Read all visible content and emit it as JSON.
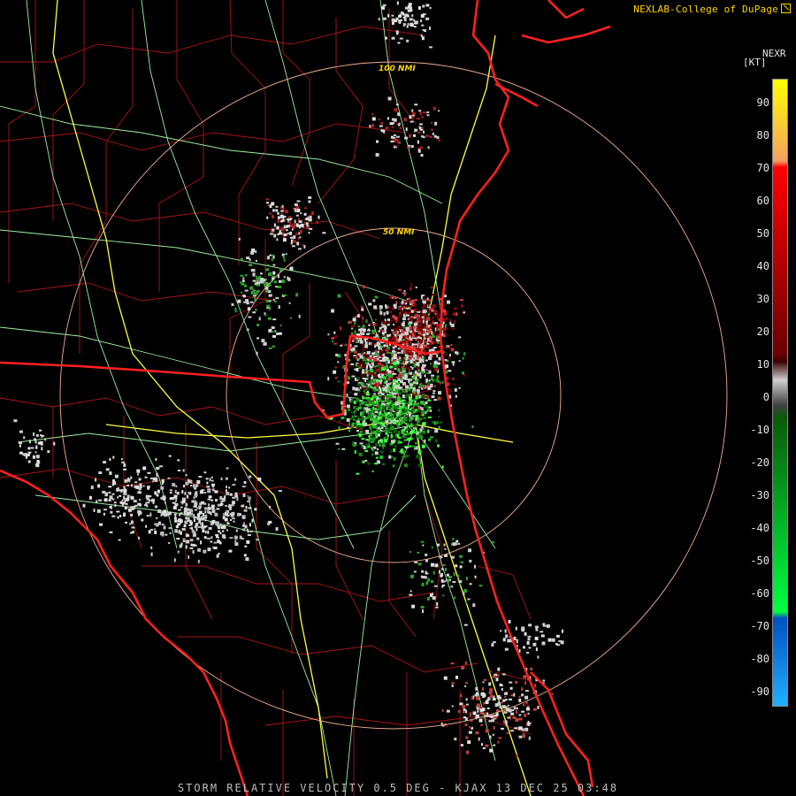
{
  "header": {
    "credit": "NEXLAB-College of DuPage",
    "credit_icon": "external-link-icon"
  },
  "legend": {
    "product": "NEXR",
    "unit": "[KT]",
    "ticks": [
      "90",
      "80",
      "70",
      "60",
      "50",
      "40",
      "30",
      "20",
      "10",
      "0",
      "-10",
      "-20",
      "-30",
      "-40",
      "-50",
      "-60",
      "-70",
      "-80",
      "-90"
    ],
    "colors": {
      "top": "#ffff00",
      "orange": "#f4a060",
      "red": "#ff0000",
      "dark_red": "#6a0000",
      "gray": "#cfcfcf",
      "dark_green": "#0a5a0a",
      "green": "#00ff40",
      "blue": "#0050c0",
      "light_blue": "#20b0ff"
    }
  },
  "rings": {
    "inner_label": "50 NMI",
    "outer_label": "100 NMI"
  },
  "map_colors": {
    "state_border": "#ff2020",
    "county_border": "#b01818",
    "interstate": "#ffff40",
    "highway": "#9ef0a0",
    "ring": "#f0b090"
  },
  "footer": {
    "caption": "STORM RELATIVE VELOCITY 0.5 DEG - KJAX 13 DEC 25 03:48"
  }
}
